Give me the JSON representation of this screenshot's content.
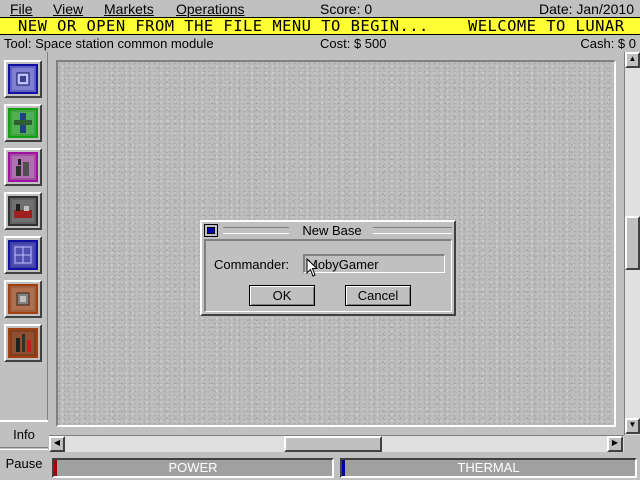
{
  "menubar": {
    "file": "File",
    "view": "View",
    "markets": "Markets",
    "operations": "Operations",
    "score": "Score: 0",
    "date": "Date: Jan/2010"
  },
  "marquee": {
    "text": "NEW OR OPEN FROM THE FILE MENU TO BEGIN...    WELCOME TO LUNAR",
    "background": "#ffff33"
  },
  "status": {
    "tool": "Tool: Space station common module",
    "cost": "Cost: $ 500",
    "cash": "Cash: $ 0"
  },
  "toolbar": {
    "tools": [
      {
        "icon": "common-module-icon",
        "color": "#1010a0"
      },
      {
        "icon": "connector-module-icon",
        "color": "#10a010"
      },
      {
        "icon": "habitat-module-icon",
        "color": "#a010a0"
      },
      {
        "icon": "factory-module-icon",
        "color": "#303030"
      },
      {
        "icon": "solar-array-icon",
        "color": "#1010a0"
      },
      {
        "icon": "mining-module-icon",
        "color": "#a04010"
      },
      {
        "icon": "launch-pad-icon",
        "color": "#a04010"
      }
    ],
    "info": "Info",
    "pause": "Pause"
  },
  "gauges": {
    "power": "POWER",
    "thermal": "THERMAL",
    "power_color": "#a00000",
    "thermal_color": "#0000a0"
  },
  "dialog": {
    "title": "New Base",
    "commander_label": "Commander:",
    "commander_value": "MobyGamer",
    "ok": "OK",
    "cancel": "Cancel"
  }
}
